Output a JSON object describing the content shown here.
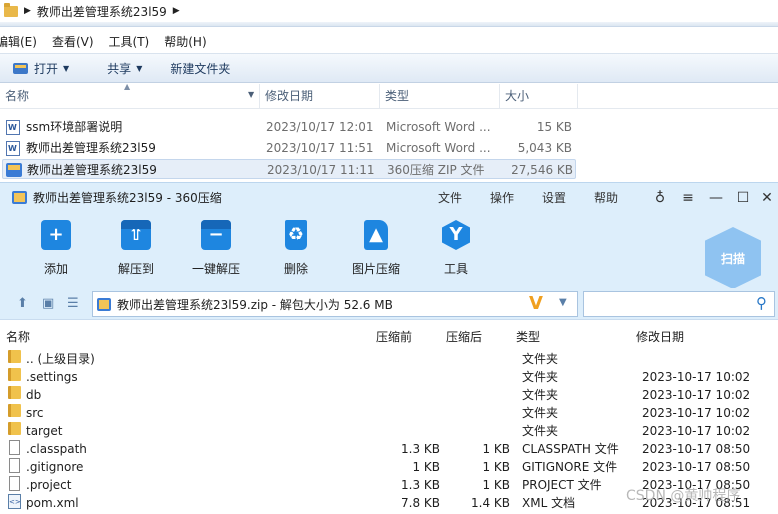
{
  "explorer": {
    "breadcrumb": "教师出差管理系统23l59",
    "menu": [
      "编辑(E)",
      "查看(V)",
      "工具(T)",
      "帮助(H)"
    ],
    "toolbar": {
      "open": "打开",
      "share": "共享",
      "new_folder": "新建文件夹"
    },
    "columns": {
      "name": "名称",
      "modified": "修改日期",
      "type": "类型",
      "size": "大小"
    },
    "rows": [
      {
        "name": "ssm环境部署说明",
        "modified": "2023/10/17 12:01",
        "type": "Microsoft Word ...",
        "size": "15 KB"
      },
      {
        "name": "教师出差管理系统23l59",
        "modified": "2023/10/17 11:51",
        "type": "Microsoft Word ...",
        "size": "5,043 KB"
      },
      {
        "name": "教师出差管理系统23l59",
        "modified": "2023/10/17 11:11",
        "type": "360压缩 ZIP 文件",
        "size": "27,546 KB"
      }
    ]
  },
  "zip": {
    "title": "教师出差管理系统23l59 - 360压缩",
    "menu": [
      "文件",
      "操作",
      "设置",
      "帮助"
    ],
    "tools": [
      "添加",
      "解压到",
      "一键解压",
      "删除",
      "图片压缩",
      "工具"
    ],
    "scan": "扫描",
    "path": "教师出差管理系统23l59.zip - 解包大小为 52.6 MB",
    "columns": {
      "name": "名称",
      "compressed": "压缩前",
      "after": "压缩后",
      "type": "类型",
      "modified": "修改日期"
    },
    "rows": [
      {
        "name": ".. (上级目录)",
        "before": "",
        "after": "",
        "type": "文件夹",
        "modified": ""
      },
      {
        "name": ".settings",
        "before": "",
        "after": "",
        "type": "文件夹",
        "modified": "2023-10-17 10:02"
      },
      {
        "name": "db",
        "before": "",
        "after": "",
        "type": "文件夹",
        "modified": "2023-10-17 10:02"
      },
      {
        "name": "src",
        "before": "",
        "after": "",
        "type": "文件夹",
        "modified": "2023-10-17 10:02"
      },
      {
        "name": "target",
        "before": "",
        "after": "",
        "type": "文件夹",
        "modified": "2023-10-17 10:02"
      },
      {
        "name": ".classpath",
        "before": "1.3 KB",
        "after": "1 KB",
        "type": "CLASSPATH 文件",
        "modified": "2023-10-17 08:50"
      },
      {
        "name": ".gitignore",
        "before": "1 KB",
        "after": "1 KB",
        "type": "GITIGNORE 文件",
        "modified": "2023-10-17 08:50"
      },
      {
        "name": ".project",
        "before": "1.3 KB",
        "after": "1 KB",
        "type": "PROJECT 文件",
        "modified": "2023-10-17 08:50"
      },
      {
        "name": "pom.xml",
        "before": "7.8 KB",
        "after": "1.4 KB",
        "type": "XML 文档",
        "modified": "2023-10-17 08:51"
      }
    ]
  },
  "watermark": "CSDN @黄帅程序"
}
